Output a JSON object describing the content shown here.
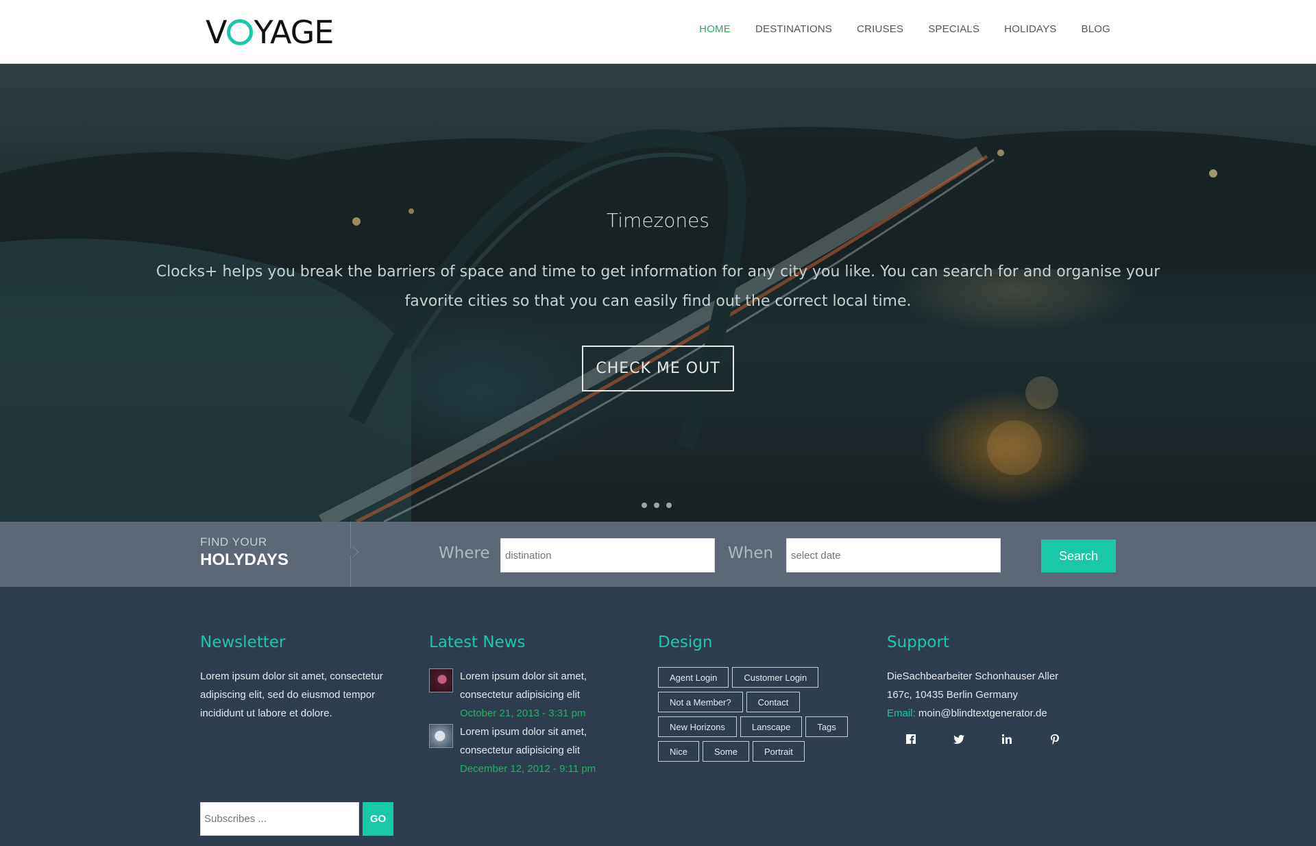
{
  "header": {
    "logo": {
      "before": "V",
      "after": "YAGE"
    },
    "nav": [
      "HOME",
      "DESTINATIONS",
      "CRIUSES",
      "SPECIALS",
      "HOLIDAYS",
      "BLOG"
    ],
    "active_nav": "HOME"
  },
  "hero": {
    "title": "Timezones",
    "text": "Clocks+ helps you break the barriers of space and time to get information for any city you like. You can search for and organise your favorite cities so that you can easily find out the correct local time.",
    "button": "CHECK ME OUT",
    "slides": 3
  },
  "finder": {
    "small": "FIND YOUR",
    "big": "HOLYDAYS",
    "where_label": "Where",
    "where_placeholder": "distination",
    "when_label": "When",
    "when_placeholder": "select date",
    "search_button": "Search"
  },
  "footer": {
    "newsletter": {
      "title": "Newsletter",
      "text": "Lorem ipsum dolor sit amet, consectetur adipiscing elit, sed do eiusmod tempor incididunt ut labore et dolore.",
      "placeholder": "Subscribes ...",
      "button": "GO"
    },
    "news": {
      "title": "Latest News",
      "items": [
        {
          "text": "Lorem ipsum dolor sit amet, consectetur adipisicing elit",
          "date": "October 21, 2013 - 3:31 pm"
        },
        {
          "text": "Lorem ipsum dolor sit amet, consectetur adipisicing elit",
          "date": "December 12, 2012 - 9:11 pm"
        }
      ]
    },
    "design": {
      "title": "Design",
      "tags": [
        "Agent Login",
        "Customer Login",
        "Not a Member?",
        "Contact",
        "New Horizons",
        "Lanscape",
        "Tags",
        "Nice",
        "Some",
        "Portrait"
      ]
    },
    "support": {
      "title": "Support",
      "address1": "DieSachbearbeiter Schonhauser Aller",
      "address2": "167c, 10435 Berlin Germany",
      "email_label": "Email:",
      "email": "moin@blindtextgenerator.de",
      "socials": [
        "facebook-icon",
        "twitter-icon",
        "linkedin-icon",
        "pinterest-icon"
      ]
    }
  },
  "colors": {
    "accent": "#18c8a6",
    "nav_active": "#27ae60",
    "footer_bg": "#2f3e4f",
    "finder_bg": "#5c6875"
  }
}
